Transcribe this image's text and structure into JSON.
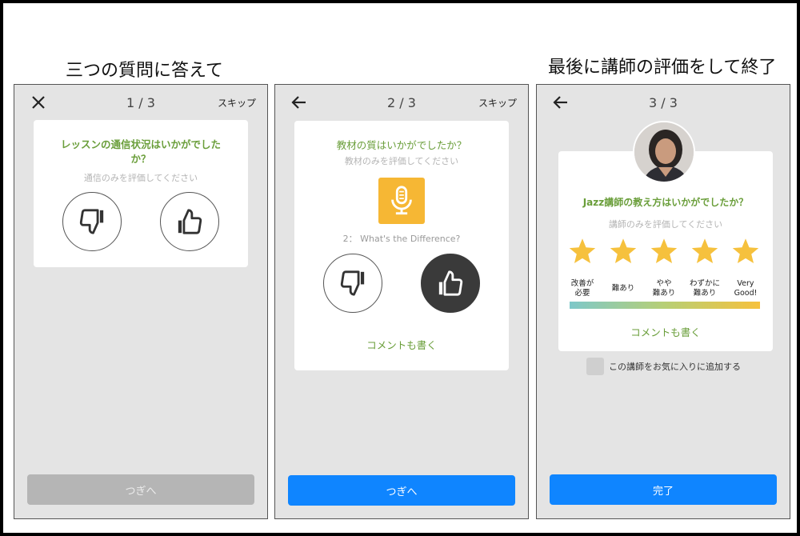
{
  "captions": {
    "left": "三つの質問に答えて",
    "right": "最後に講師の評価をして終了"
  },
  "screen1": {
    "progress": "1 / 3",
    "skip": "スキップ",
    "nav_icon": "close-icon",
    "question": "レッスンの通信状況はいかがでしたか？",
    "subtitle": "通信のみを評価してください",
    "next_label": "つぎへ"
  },
  "screen2": {
    "progress": "2 / 3",
    "skip": "スキップ",
    "nav_icon": "back-arrow-icon",
    "question": "教材の質はいかがでしたか？",
    "subtitle": "教材のみを評価してください",
    "material": "2： What's the Difference?",
    "comment": "コメントも書く",
    "next_label": "つぎへ"
  },
  "screen3": {
    "progress": "3 / 3",
    "nav_icon": "back-arrow-icon",
    "question": "Jazz講師の教え方はいかがでしたか？",
    "subtitle": "講師のみを評価してください",
    "star_labels": [
      "改善が\n必要",
      "難あり",
      "やや\n難あり",
      "わずかに\n難あり",
      "Very\nGood!"
    ],
    "comment": "コメントも書く",
    "favorite": "この講師をお気に入りに追加する",
    "done_label": "完了"
  },
  "colors": {
    "accent_green": "#6a9e3a",
    "primary_blue": "#0f85ff",
    "star_yellow": "#f6c13d",
    "mic_orange": "#f6b734"
  }
}
